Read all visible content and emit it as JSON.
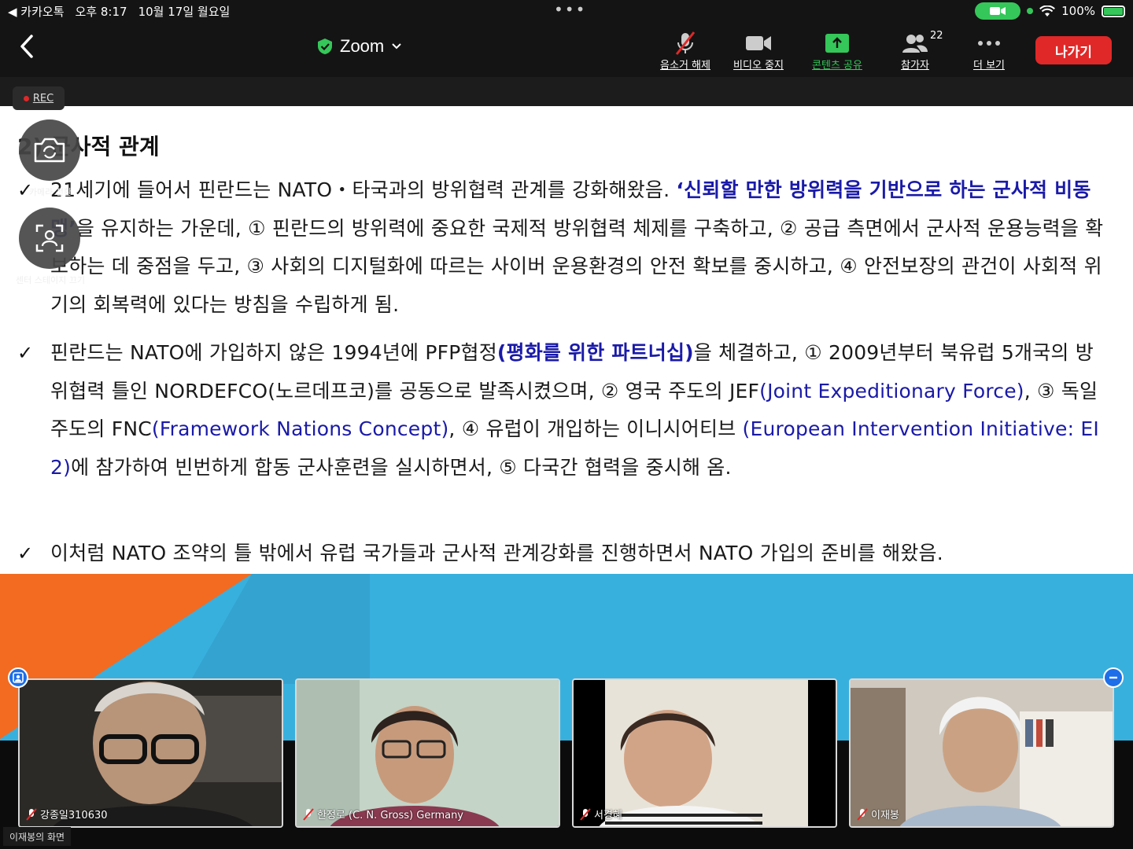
{
  "status_bar": {
    "back_app": "◀ 카카오톡",
    "time": "오후 8:17",
    "date": "10월 17일 월요일",
    "battery": "100%"
  },
  "toolbar": {
    "title": "Zoom",
    "tools": [
      {
        "name": "unmute",
        "label": "음소거 해제"
      },
      {
        "name": "stop-video",
        "label": "비디오 중지"
      },
      {
        "name": "share-content",
        "label": "콘텐츠 공유"
      },
      {
        "name": "participants",
        "label": "참가자"
      },
      {
        "name": "more",
        "label": "더 보기"
      }
    ],
    "participant_count": "22",
    "leave_label": "나가기"
  },
  "rec_label": "REC",
  "float": {
    "switch_camera_label": "카메라 전환",
    "center_stage_label": "센터 스테이지 끄기"
  },
  "slide": {
    "heading": "2) 군사적 관계",
    "check": "✓",
    "p1": {
      "a": "21세기에 들어서 핀란드는 NATO・타국과의 방위협력 관계를 강화해왔음. ",
      "b": "‘신뢰할 만한 방위력을 기반으로 하는 군사적 비동맹’",
      "c": "을 유지하는 가운데, ① 핀란드의 방위력에 중요한 국제적 방위협력 체제를 구축하고, ② 공급 측면에서 군사적 운용능력을 확보하는 데 중점을 두고, ③ 사회의 디지털화에 따르는 사이버 운용환경의 안전 확보를 중시하고, ④ 안전보장의 관건이 사회적 위기의 회복력에 있다는 방침을 수립하게 됨."
    },
    "p2": {
      "a": "핀란드는 NATO에 가입하지 않은 1994년에 PFP협정",
      "b": "(평화를 위한 파트너십)",
      "c": "을 체결하고, ① 2009년부터 북유럽 5개국의 방위협력 틀인 NORDEFCO(노르데프코)를 공동으로 발족시켰으며, ② 영국 주도의 JEF",
      "d": "(Joint Expeditionary Force)",
      "e": ", ③ 독일 주도의 FNC",
      "f": "(Framework Nations Concept)",
      "g": ", ④ 유럽이 개입하는 이니시어티브 ",
      "h": "(European Intervention Initiative: EI 2)",
      "i": "에 참가하여 빈번하게 합동 군사훈련을 실시하면서, ⑤ 다국간 협력을 중시해 옴."
    },
    "p3": "이처럼 NATO 조약의 틀 밖에서 유럽 국가들과 군사적 관계강화를 진행하면서 NATO 가입의 준비를 해왔음."
  },
  "participants": [
    {
      "name": "강종일310630"
    },
    {
      "name": "한정로 (C. N. Gross) Germany"
    },
    {
      "name": "서경혜"
    },
    {
      "name": "이재봉"
    }
  ],
  "screen_owner": "이재봉의 화면",
  "colors": {
    "accent_green": "#35c759",
    "leave_red": "#e02828",
    "slide_blue": "#1a1aa8",
    "bg_cyan": "#38b0de",
    "bg_orange": "#f26b21"
  }
}
